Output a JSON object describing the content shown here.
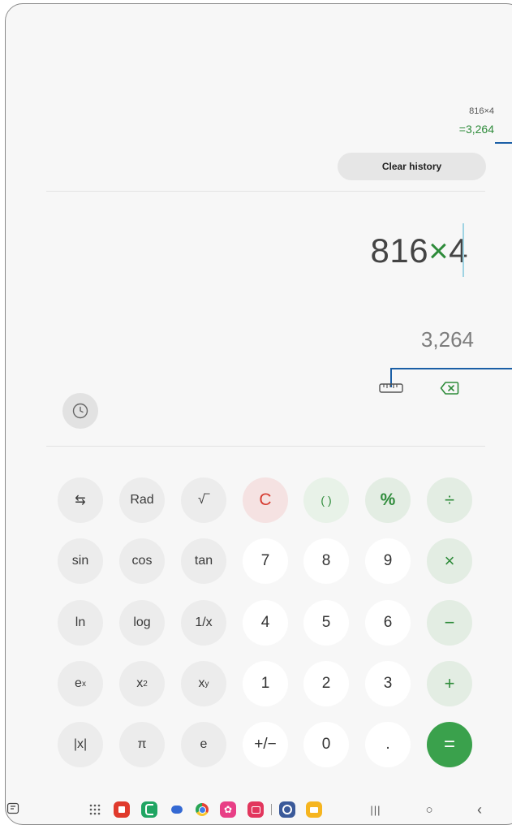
{
  "history": {
    "expression": "816×4",
    "result": "=3,264",
    "clear_label": "Clear history"
  },
  "display": {
    "expr_left": "816",
    "expr_op": "×",
    "expr_right": "4",
    "preview": "3,264"
  },
  "toolbar": {
    "history_icon": "clock-icon",
    "unit_icon": "ruler-icon",
    "backspace_icon": "backspace-icon"
  },
  "keys": {
    "swap": "⇆",
    "rad": "Rad",
    "sqrt": "√‾",
    "clear": "C",
    "paren": "( )",
    "percent": "%",
    "divide": "÷",
    "sin": "sin",
    "cos": "cos",
    "tan": "tan",
    "n7": "7",
    "n8": "8",
    "n9": "9",
    "multiply": "×",
    "ln": "ln",
    "log": "log",
    "inv": "1/x",
    "n4": "4",
    "n5": "5",
    "n6": "6",
    "minus": "−",
    "ex_base": "e",
    "ex_sup": "x",
    "x2_base": "x",
    "x2_sup": "2",
    "xy_base": "x",
    "xy_sup": "y",
    "n1": "1",
    "n2": "2",
    "n3": "3",
    "plus": "+",
    "abs": "|x|",
    "pi": "π",
    "e": "e",
    "negate": "+/−",
    "n0": "0",
    "dot": ".",
    "equals": "="
  },
  "colors": {
    "accent_green": "#3aa14c",
    "clear_red": "#d63b30",
    "callout_blue": "#1b5fa6"
  },
  "navbar": {
    "apps": [
      "apps-grid-icon",
      "flipboard-icon",
      "phone-icon",
      "messages-icon",
      "chrome-icon",
      "galaxy-store-icon",
      "camera-icon",
      "settings-icon",
      "files-icon"
    ],
    "recents": "|||",
    "home": "○",
    "back": "‹"
  }
}
